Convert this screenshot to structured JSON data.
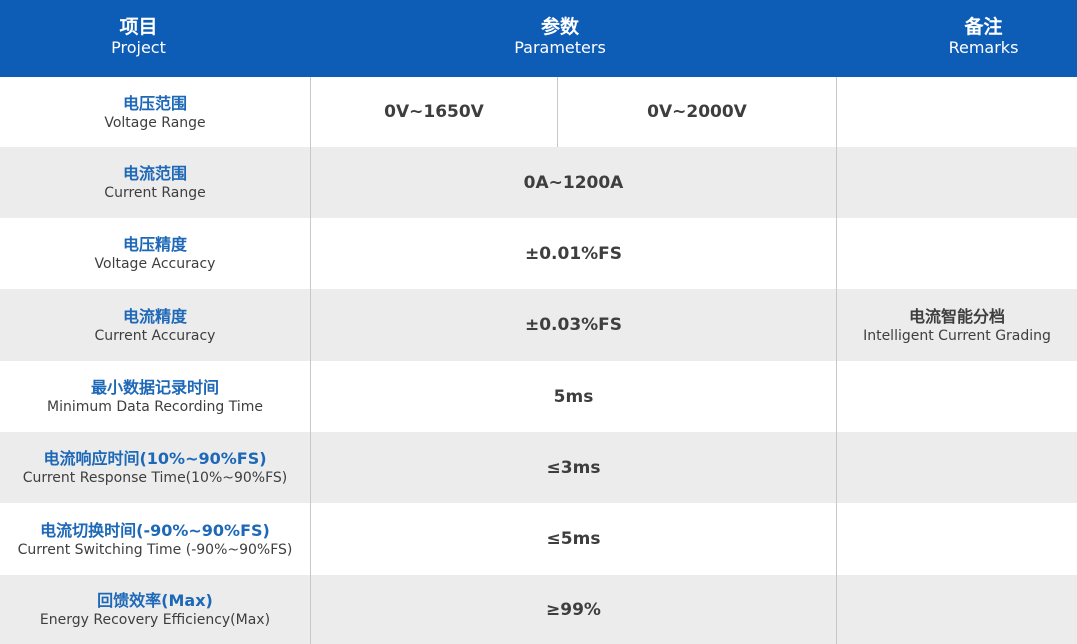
{
  "header": {
    "project": {
      "zh": "项目",
      "en": "Project"
    },
    "parameters": {
      "zh": "参数",
      "en": "Parameters"
    },
    "remarks": {
      "zh": "备注",
      "en": "Remarks"
    }
  },
  "rows": [
    {
      "item_zh": "电压范围",
      "item_en": "Voltage Range",
      "param_a": "0V~1650V",
      "param_b": "0V~2000V"
    },
    {
      "item_zh": "电流范围",
      "item_en": "Current Range",
      "param": "0A~1200A"
    },
    {
      "item_zh": "电压精度",
      "item_en": "Voltage Accuracy",
      "param": "±0.01%FS"
    },
    {
      "item_zh": "电流精度",
      "item_en": "Current Accuracy",
      "param": "±0.03%FS",
      "remark_zh": "电流智能分档",
      "remark_en": "Intelligent Current Grading"
    },
    {
      "item_zh": "最小数据记录时间",
      "item_en": "Minimum Data Recording Time",
      "param": "5ms"
    },
    {
      "item_zh": "电流响应时间(10%~90%FS)",
      "item_en": "Current Response Time(10%~90%FS)",
      "param": "≤3ms"
    },
    {
      "item_zh": "电流切换时间(-90%~90%FS)",
      "item_en": "Current Switching Time (-90%~90%FS)",
      "param": "≤5ms"
    },
    {
      "item_zh": "回馈效率(Max)",
      "item_en": "Energy Recovery Efficiency(Max)",
      "param": "≥99%"
    }
  ],
  "colors": {
    "header_bg": "#0d5cb6",
    "item_text": "#1e68b8",
    "shaded_row": "#ececec"
  }
}
